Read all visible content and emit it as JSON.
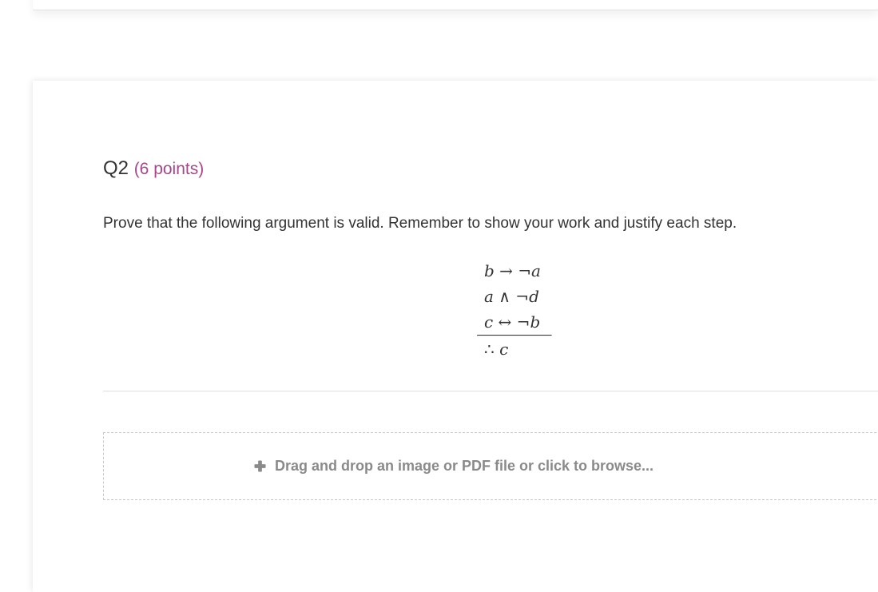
{
  "question": {
    "label": "Q2",
    "points": "(6 points)",
    "prompt": "Prove that the following argument is valid. Remember to show your work and justify each step."
  },
  "argument": {
    "premises": [
      {
        "left": "b",
        "op": " → ¬",
        "right": "a"
      },
      {
        "left": "a",
        "op": " ∧ ¬",
        "right": "d"
      },
      {
        "left": "c",
        "op": " ↔ ¬",
        "right": "b"
      }
    ],
    "therefore_symbol": "∴ ",
    "conclusion": "c"
  },
  "upload": {
    "icon": "plus-icon",
    "label": "Drag and drop an image or PDF file or click to browse..."
  },
  "colors": {
    "points_accent": "#a8468a",
    "text": "#333333",
    "upload_text": "#8a8a8a"
  }
}
